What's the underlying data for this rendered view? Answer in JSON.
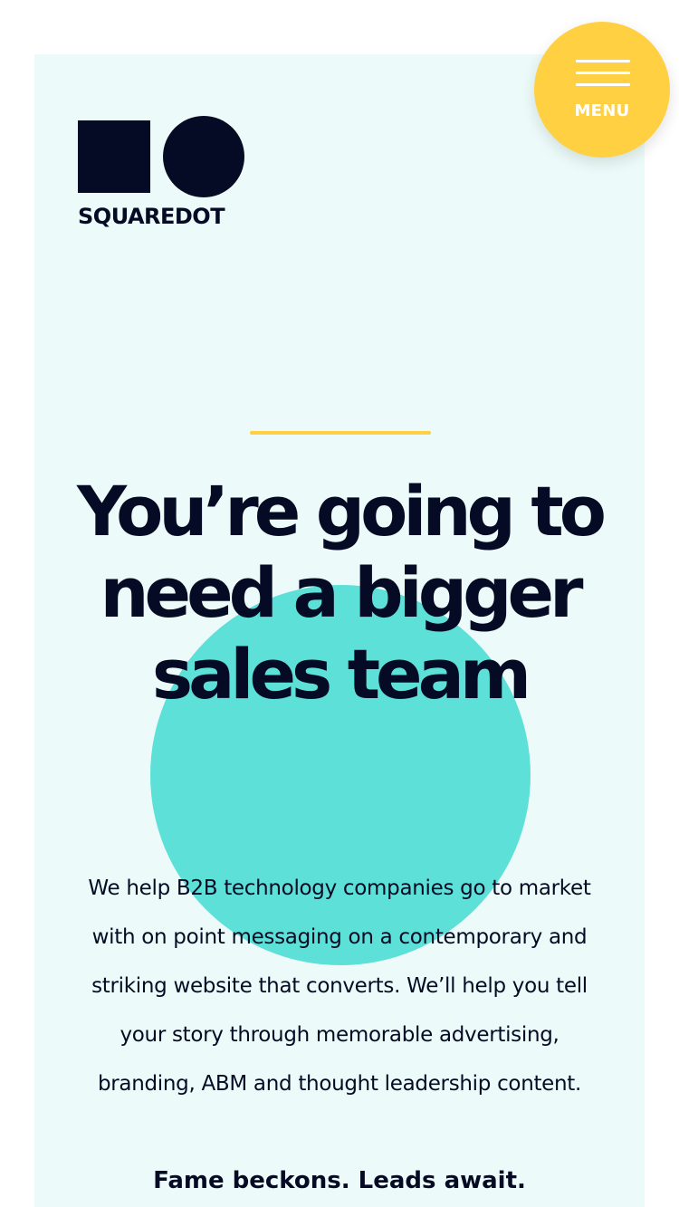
{
  "brand": {
    "name": "SQUAREDOT"
  },
  "menu": {
    "label": "MENU",
    "icon": "hamburger-icon"
  },
  "hero": {
    "headline": "You’re going to need a bigger sales team",
    "body": "We help B2B technology companies go to market with on point messaging on a contemporary and striking website that converts. We’ll help you tell your story through memorable advertising, branding, ABM and thought leadership content.",
    "tagline": "Fame beckons. Leads await."
  },
  "colors": {
    "background_panel": "#ecfbf9",
    "accent_yellow": "#ffd042",
    "accent_teal": "#5ce0d8",
    "text_dark": "#050b24"
  }
}
